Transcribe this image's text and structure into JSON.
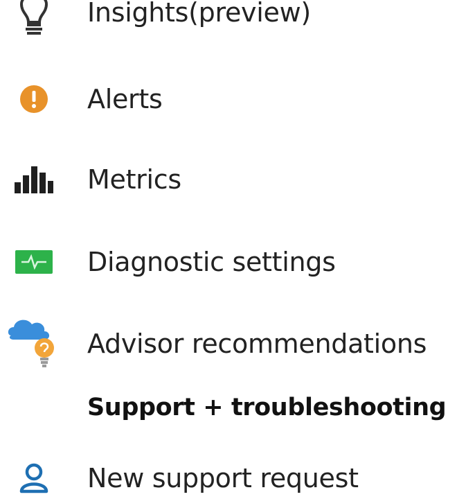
{
  "menu": {
    "items": [
      {
        "id": "insights",
        "label": "Insights(preview)",
        "icon": "lightbulb-icon"
      },
      {
        "id": "alerts",
        "label": "Alerts",
        "icon": "alert-icon"
      },
      {
        "id": "metrics",
        "label": "Metrics",
        "icon": "metrics-icon"
      },
      {
        "id": "diagnostic",
        "label": "Diagnostic settings",
        "icon": "diagnostic-settings-icon"
      },
      {
        "id": "advisor",
        "label": "Advisor recommendations",
        "icon": "advisor-icon"
      }
    ],
    "section_header": "Support + troubleshooting",
    "support_items": [
      {
        "id": "new-support-request",
        "label": "New support request",
        "icon": "person-icon"
      }
    ]
  },
  "colors": {
    "alert_orange": "#E8922A",
    "metrics_dark": "#1F1F1F",
    "diagnostic_green": "#2DB24A",
    "advisor_blue": "#3A8EDB",
    "advisor_bulb": "#F2A53A",
    "support_blue": "#1E6FB2"
  }
}
